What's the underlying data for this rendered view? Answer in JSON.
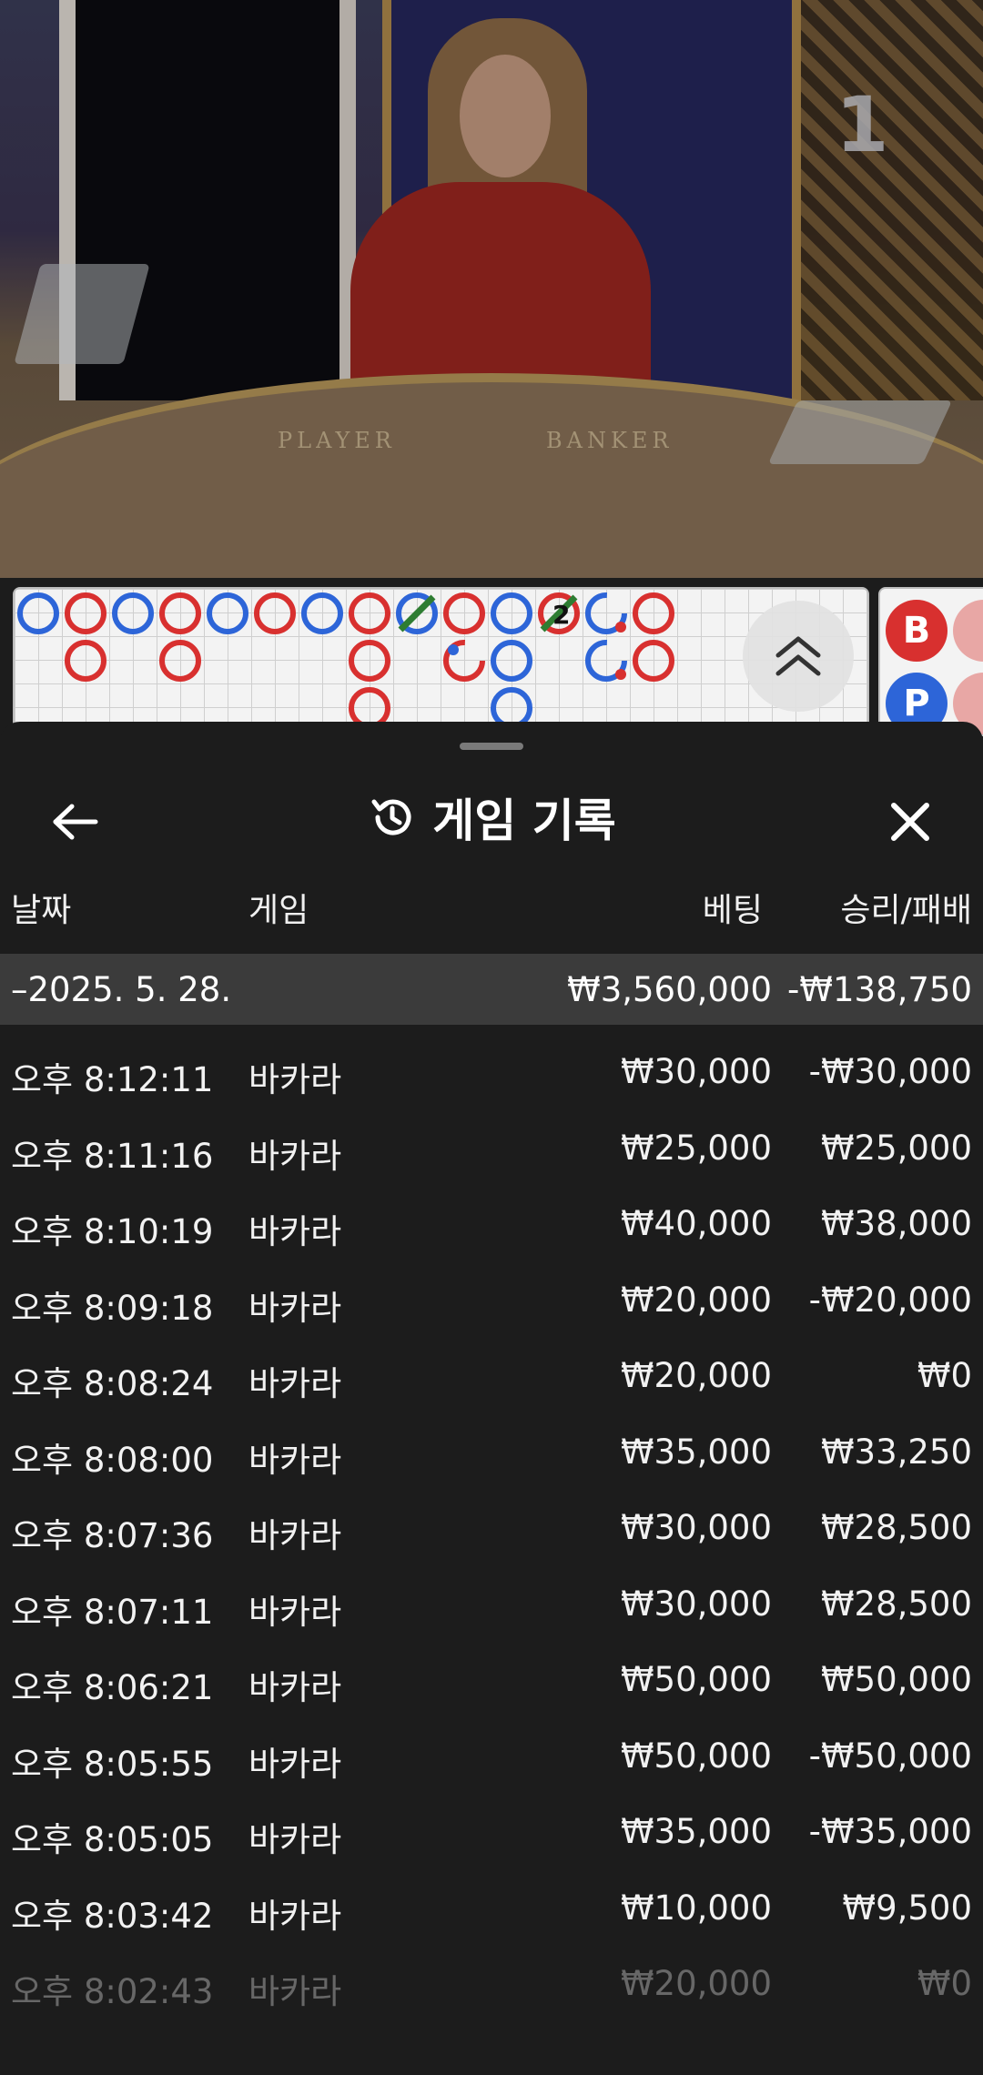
{
  "video": {
    "round_number": "1",
    "table_labels": {
      "player": "PLAYER",
      "banker": "BANKER"
    }
  },
  "roadmap": {
    "expand_icon": "double-chevron-up-icon",
    "tie_count_label": "2",
    "side_buttons": {
      "banker": "B",
      "player": "P"
    },
    "colors": {
      "player": "#2d65d8",
      "banker": "#d8302f",
      "tie": "#2e7d32"
    }
  },
  "sheet": {
    "title": "게임 기록",
    "title_icon": "history-icon",
    "back_icon": "arrow-left-icon",
    "close_icon": "close-icon",
    "columns": {
      "date": "날짜",
      "game": "게임",
      "bet": "베팅",
      "winloss": "승리/패배"
    },
    "date_group": {
      "label": "–2025. 5. 28.",
      "bet": "₩3,560,000",
      "winloss": "-₩138,750"
    },
    "rows": [
      {
        "time": "오후 8:12:11",
        "game": "바카라",
        "bet": "₩30,000",
        "winloss": "-₩30,000"
      },
      {
        "time": "오후 8:11:16",
        "game": "바카라",
        "bet": "₩25,000",
        "winloss": "₩25,000"
      },
      {
        "time": "오후 8:10:19",
        "game": "바카라",
        "bet": "₩40,000",
        "winloss": "₩38,000"
      },
      {
        "time": "오후 8:09:18",
        "game": "바카라",
        "bet": "₩20,000",
        "winloss": "-₩20,000"
      },
      {
        "time": "오후 8:08:24",
        "game": "바카라",
        "bet": "₩20,000",
        "winloss": "₩0"
      },
      {
        "time": "오후 8:08:00",
        "game": "바카라",
        "bet": "₩35,000",
        "winloss": "₩33,250"
      },
      {
        "time": "오후 8:07:36",
        "game": "바카라",
        "bet": "₩30,000",
        "winloss": "₩28,500"
      },
      {
        "time": "오후 8:07:11",
        "game": "바카라",
        "bet": "₩30,000",
        "winloss": "₩28,500"
      },
      {
        "time": "오후 8:06:21",
        "game": "바카라",
        "bet": "₩50,000",
        "winloss": "₩50,000"
      },
      {
        "time": "오후 8:05:55",
        "game": "바카라",
        "bet": "₩50,000",
        "winloss": "-₩50,000"
      },
      {
        "time": "오후 8:05:05",
        "game": "바카라",
        "bet": "₩35,000",
        "winloss": "-₩35,000"
      },
      {
        "time": "오후 8:03:42",
        "game": "바카라",
        "bet": "₩10,000",
        "winloss": "₩9,500"
      },
      {
        "time": "오후 8:02:43",
        "game": "바카라",
        "bet": "₩20,000",
        "winloss": "₩0"
      }
    ]
  }
}
